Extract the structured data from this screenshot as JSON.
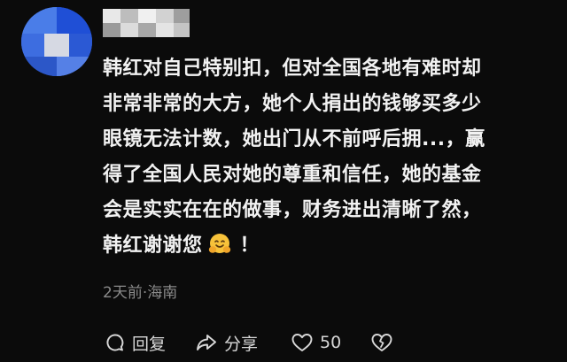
{
  "comment": {
    "lines": [
      "韩红对自己特别扣，但对全国各地有难时却",
      "非常非常的大方，她个人捐出的钱够买多少",
      "眼镜无法计数，她出门从不前呼后拥...，赢",
      "得了全国人民对她的尊重和信任，她的基金",
      "会是实实在在的做事，财务进出清晰了然，"
    ],
    "last_line_text": "韩红谢谢您",
    "last_line_emoji": "hugging-face-emoji",
    "last_line_tail": "！"
  },
  "meta": {
    "time_location": "2天前·海南"
  },
  "actions": {
    "reply_label": "回复",
    "share_label": "分享",
    "like_count": "50"
  },
  "colors": {
    "background": "#0b0b0b",
    "text": "#f2f2f2",
    "meta_text": "#8a8a8a",
    "action_text": "#d8d8d8"
  }
}
